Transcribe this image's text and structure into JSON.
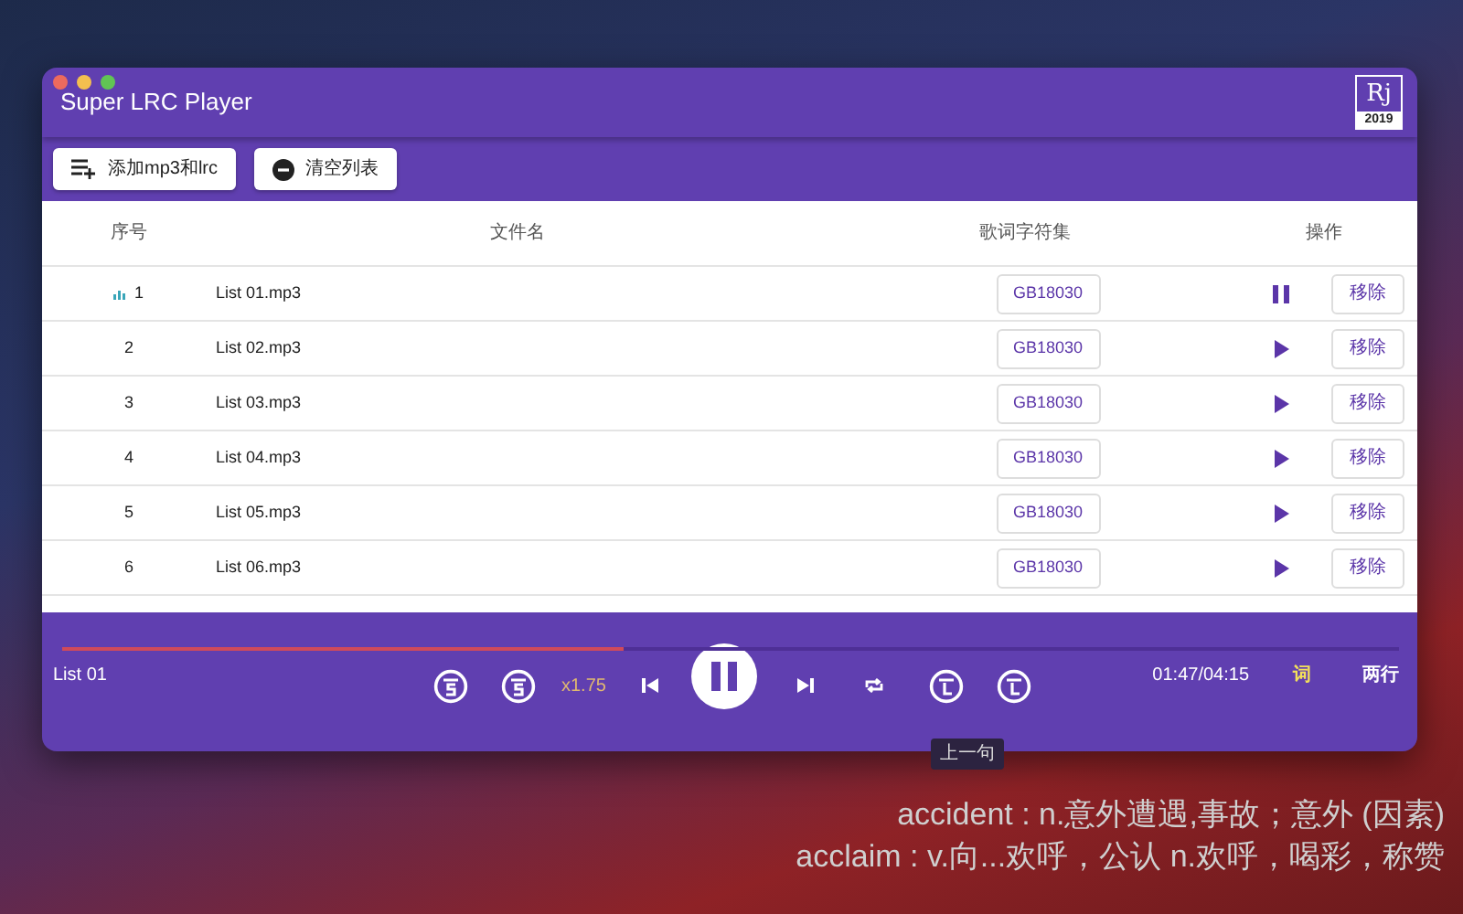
{
  "window": {
    "title": "Super LRC Player",
    "logo": {
      "letters": "Rj",
      "year": "2019"
    }
  },
  "toolbar": {
    "buttons": [
      {
        "kind": "add",
        "label": "添加mp3和lrc"
      },
      {
        "kind": "clear",
        "label": "清空列表"
      }
    ]
  },
  "table": {
    "columns": [
      "序号",
      "文件名",
      "歌词字符集",
      "操作"
    ],
    "rows": [
      {
        "index": "1",
        "file": "List 01.mp3",
        "charset": "GB18030",
        "playing": true,
        "remove": "移除"
      },
      {
        "index": "2",
        "file": "List 02.mp3",
        "charset": "GB18030",
        "playing": false,
        "remove": "移除"
      },
      {
        "index": "3",
        "file": "List 03.mp3",
        "charset": "GB18030",
        "playing": false,
        "remove": "移除"
      },
      {
        "index": "4",
        "file": "List 04.mp3",
        "charset": "GB18030",
        "playing": false,
        "remove": "移除"
      },
      {
        "index": "5",
        "file": "List 05.mp3",
        "charset": "GB18030",
        "playing": false,
        "remove": "移除"
      },
      {
        "index": "6",
        "file": "List 06.mp3",
        "charset": "GB18030",
        "playing": false,
        "remove": "移除"
      }
    ]
  },
  "player": {
    "progress": {
      "level": 0.42
    },
    "track": "List 01",
    "speed": "x1.75",
    "playing": true,
    "time": "01:47/04:15",
    "lyrics_toggle": {
      "label": "词",
      "on": true
    },
    "lines_toggle": {
      "label": "两行",
      "on": false
    },
    "tooltip": "上一句"
  },
  "desktop_lyrics": [
    "accident : n.意外遭遇,事故；意外 (因素)",
    "acclaim : v.向...欢呼，公认 n.欢呼，喝彩，称赞"
  ]
}
